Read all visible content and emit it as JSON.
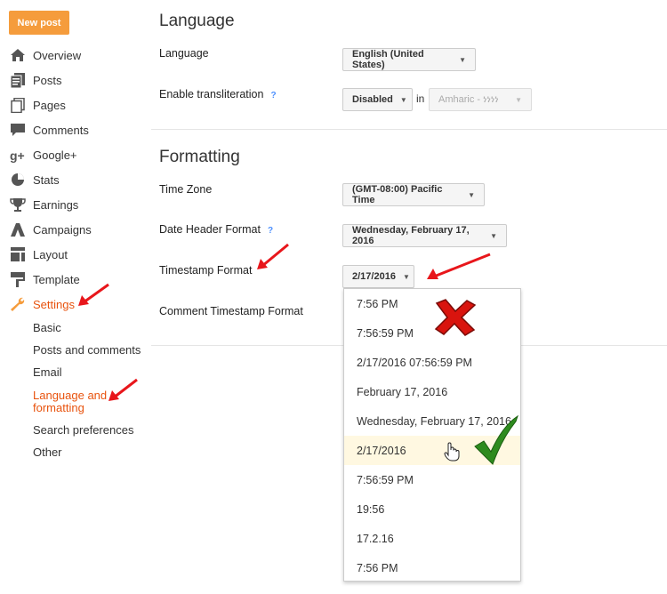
{
  "sidebar": {
    "new_post": "New post",
    "items": [
      {
        "label": "Overview",
        "icon": "home-icon"
      },
      {
        "label": "Posts",
        "icon": "posts-icon"
      },
      {
        "label": "Pages",
        "icon": "pages-icon"
      },
      {
        "label": "Comments",
        "icon": "comments-icon"
      },
      {
        "label": "Google+",
        "icon": "google-plus-icon"
      },
      {
        "label": "Stats",
        "icon": "stats-icon"
      },
      {
        "label": "Earnings",
        "icon": "trophy-icon"
      },
      {
        "label": "Campaigns",
        "icon": "campaigns-icon"
      },
      {
        "label": "Layout",
        "icon": "layout-icon"
      },
      {
        "label": "Template",
        "icon": "template-icon"
      },
      {
        "label": "Settings",
        "icon": "wrench-icon"
      }
    ],
    "settings_sub": [
      {
        "label": "Basic"
      },
      {
        "label": "Posts and comments"
      },
      {
        "label": "Email"
      },
      {
        "label": "Language and formatting"
      },
      {
        "label": "Search preferences"
      },
      {
        "label": "Other"
      }
    ]
  },
  "language": {
    "title": "Language",
    "language_label": "Language",
    "language_value": "English (United States)",
    "translit_label": "Enable transliteration",
    "help": "?",
    "translit_value": "Disabled",
    "in_text": "in",
    "translit_lang": "Amharic - ነነነነ"
  },
  "formatting": {
    "title": "Formatting",
    "timezone_label": "Time Zone",
    "timezone_value": "(GMT-08:00) Pacific Time",
    "date_header_label": "Date Header Format",
    "help": "?",
    "date_header_value": "Wednesday, February 17, 2016",
    "timestamp_label": "Timestamp Format",
    "timestamp_value": "2/17/2016",
    "comment_timestamp_label": "Comment Timestamp Format"
  },
  "dropdown": {
    "options": [
      "7:56 PM",
      "7:56:59 PM",
      "2/17/2016 07:56:59 PM",
      "February 17, 2016",
      "Wednesday, February 17, 2016",
      "2/17/2016",
      "7:56:59 PM",
      "19:56",
      "17.2.16",
      "7:56 PM"
    ],
    "selected_index": 5
  },
  "colors": {
    "accent": "#e8530e",
    "button": "#f59c3c",
    "arrow": "#e8161b",
    "check": "#2e8b1e"
  }
}
